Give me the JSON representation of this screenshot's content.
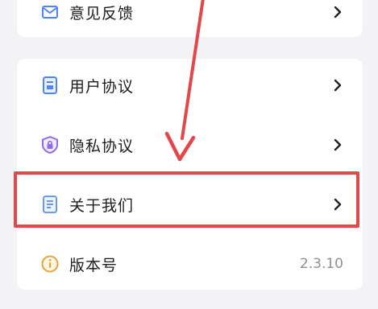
{
  "menu_top": {
    "feedback": {
      "label": "意见反馈",
      "icon": "mail-icon"
    }
  },
  "menu_main": {
    "items": [
      {
        "label": "用户协议",
        "icon": "document-icon",
        "chevron": true
      },
      {
        "label": "隐私协议",
        "icon": "shield-lock-icon",
        "chevron": true
      },
      {
        "label": "关于我们",
        "icon": "document-icon",
        "chevron": true
      },
      {
        "label": "版本号",
        "icon": "info-icon",
        "value": "2.3.10"
      }
    ]
  },
  "annotation": {
    "highlight_color": "#e2474a",
    "highlighted_item": "关于我们"
  },
  "colors": {
    "accent_blue": "#4f86f7",
    "accent_purple": "#8e6ee8",
    "accent_orange": "#e6a23c"
  }
}
